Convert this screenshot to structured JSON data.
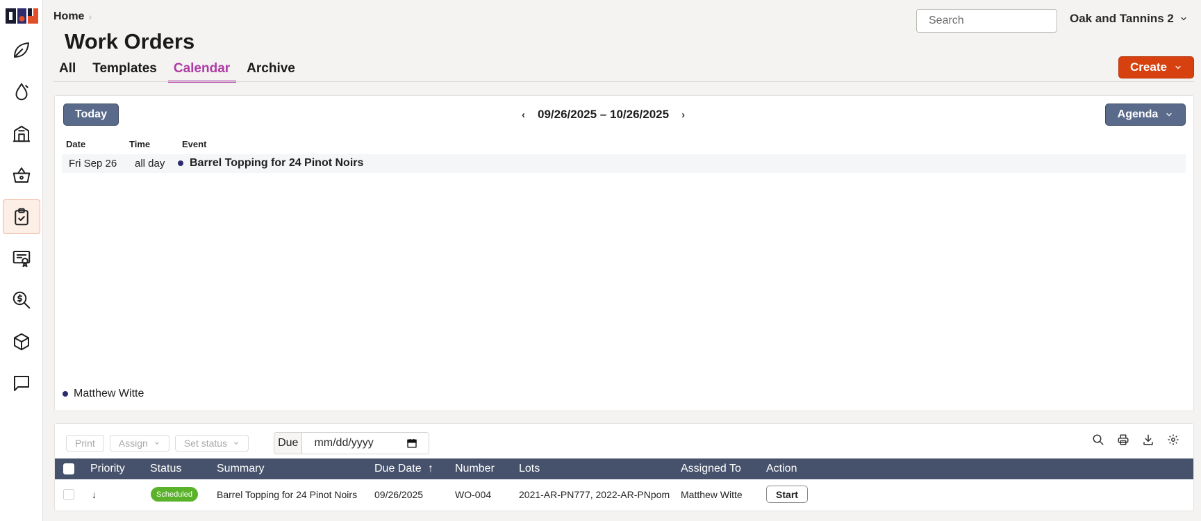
{
  "breadcrumb": {
    "home": "Home",
    "separator": "›"
  },
  "page": {
    "title": "Work Orders"
  },
  "search": {
    "placeholder": "Search"
  },
  "org": {
    "name": "Oak and Tannins 2"
  },
  "tabs": [
    {
      "label": "All",
      "active": false
    },
    {
      "label": "Templates",
      "active": false
    },
    {
      "label": "Calendar",
      "active": true
    },
    {
      "label": "Archive",
      "active": false
    }
  ],
  "create_button": {
    "label": "Create"
  },
  "sidebar": {
    "items": [
      {
        "icon": "leaf-icon"
      },
      {
        "icon": "flame-drop-icon"
      },
      {
        "icon": "building-icon"
      },
      {
        "icon": "basket-icon"
      },
      {
        "icon": "clipboard-check-icon",
        "active": true
      },
      {
        "icon": "certificate-icon"
      },
      {
        "icon": "dollar-search-icon"
      },
      {
        "icon": "cube-icon"
      },
      {
        "icon": "chat-icon"
      }
    ]
  },
  "calendar": {
    "today_label": "Today",
    "range": "09/26/2025 – 10/26/2025",
    "prev": "‹",
    "next": "›",
    "view_label": "Agenda",
    "headers": {
      "date": "Date",
      "time": "Time",
      "event": "Event"
    },
    "events": [
      {
        "date": "Fri Sep 26",
        "time": "all day",
        "title": "Barrel Topping for 24 Pinot Noirs"
      }
    ],
    "legend": [
      {
        "name": "Matthew Witte",
        "color": "#2d2a6e"
      }
    ]
  },
  "table": {
    "toolbar": {
      "print": "Print",
      "assign": "Assign",
      "set_status": "Set status",
      "due_label": "Due",
      "due_placeholder": "mm/dd/yyyy"
    },
    "columns": {
      "priority": "Priority",
      "status": "Status",
      "summary": "Summary",
      "due_date": "Due Date",
      "sort_indicator": "↑",
      "number": "Number",
      "lots": "Lots",
      "assigned_to": "Assigned To",
      "action": "Action"
    },
    "rows": [
      {
        "priority": "↓",
        "status": "Scheduled",
        "summary": "Barrel Topping for 24 Pinot Noirs",
        "due_date": "09/26/2025",
        "number": "WO-004",
        "lots": "2021-AR-PN777, 2022-AR-PNpom",
        "assigned_to": "Matthew Witte",
        "action": "Start"
      }
    ]
  },
  "colors": {
    "accent_tab": "#b03aa8",
    "create": "#d6410f",
    "nav_button": "#5a6a8a",
    "table_header": "#46526b",
    "status_scheduled": "#5ab22b"
  }
}
